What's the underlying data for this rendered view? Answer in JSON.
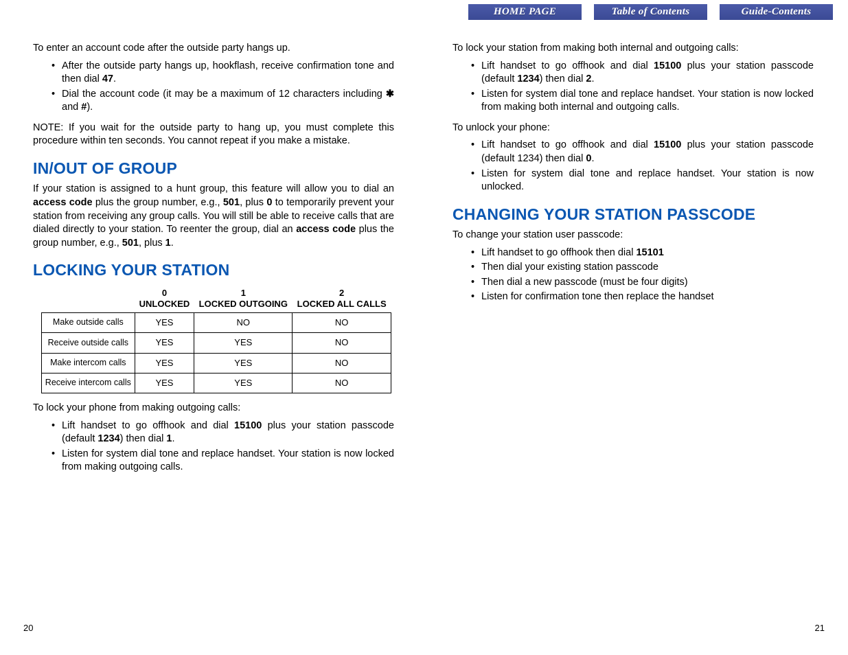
{
  "nav": {
    "home": "HOME PAGE",
    "toc": "Table of Contents",
    "guide": "Guide-Contents"
  },
  "left": {
    "intro": "To enter an account code after the outside party hangs up.",
    "li1a": "After the outside party hangs up, hookflash, receive confirmation tone and then dial ",
    "li1b": "47",
    "li1c": ".",
    "li2a": "Dial the account code (it may be a maximum of 12 characters including ",
    "li2b": "✱",
    "li2c": " and ",
    "li2d": "#",
    "li2e": ").",
    "note": "NOTE: If you wait for the outside party to hang up, you must complete this procedure within ten seconds. You cannot repeat if you make a mistake.",
    "h_inout": "IN/OUT OF GROUP",
    "inout_a": "If your station is assigned to a hunt group, this feature will allow you to dial an ",
    "inout_b": "access code",
    "inout_c": " plus the group number, e.g., ",
    "inout_d": "501",
    "inout_e": ", plus ",
    "inout_f": "0",
    "inout_g": " to temporarily prevent your station from receiving any group calls. You will still be able to receive calls that are dialed directly to your station. To reenter the group, dial an ",
    "inout_h": "access code",
    "inout_i": " plus the group number, e.g., ",
    "inout_j": "501",
    "inout_k": ", plus ",
    "inout_l": "1",
    "inout_m": ".",
    "h_lock": "LOCKING YOUR STATION",
    "table": {
      "head0a": "0",
      "head0b": "UNLOCKED",
      "head1a": "1",
      "head1b": "LOCKED OUTGOING",
      "head2a": "2",
      "head2b": "LOCKED ALL CALLS",
      "r1": "Make outside calls",
      "r2": "Receive outside calls",
      "r3": "Make intercom calls",
      "r4": "Receive intercom calls",
      "yes": "YES",
      "no": "NO"
    },
    "lock_intro": "To lock your phone from making outgoing calls:",
    "lock1a": "Lift handset to go offhook and dial ",
    "lock1b": "15100",
    "lock1c": " plus your station passcode (default ",
    "lock1d": "1234",
    "lock1e": ") then dial ",
    "lock1f": "1",
    "lock1g": ".",
    "lock2": "Listen for system dial tone and replace handset. Your station is now locked from making outgoing calls."
  },
  "right": {
    "both_intro": "To lock your station from making both internal and outgoing calls:",
    "both1a": "Lift handset to go offhook and dial ",
    "both1b": "15100",
    "both1c": " plus your station passcode (default ",
    "both1d": "1234",
    "both1e": ") then dial ",
    "both1f": "2",
    "both1g": ".",
    "both2": "Listen for system dial tone and replace handset. Your station is now locked from making both internal and outgoing calls.",
    "unlock_intro": "To unlock your phone:",
    "un1a": "Lift handset to go offhook and dial ",
    "un1b": "15100",
    "un1c": " plus your station passcode (default 1234) then dial ",
    "un1d": "0",
    "un1e": ".",
    "un2": "Listen for system dial tone and replace handset. Your station is now unlocked.",
    "h_pass": "CHANGING YOUR STATION PASSCODE",
    "pass_intro": "To change your station user passcode:",
    "p1a": "Lift handset to go offhook then dial ",
    "p1b": "15101",
    "p2": "Then dial your existing station passcode",
    "p3": "Then dial a new passcode (must be four digits)",
    "p4": "Listen for confirmation tone then replace the handset"
  },
  "pagenums": {
    "left": "20",
    "right": "21"
  }
}
